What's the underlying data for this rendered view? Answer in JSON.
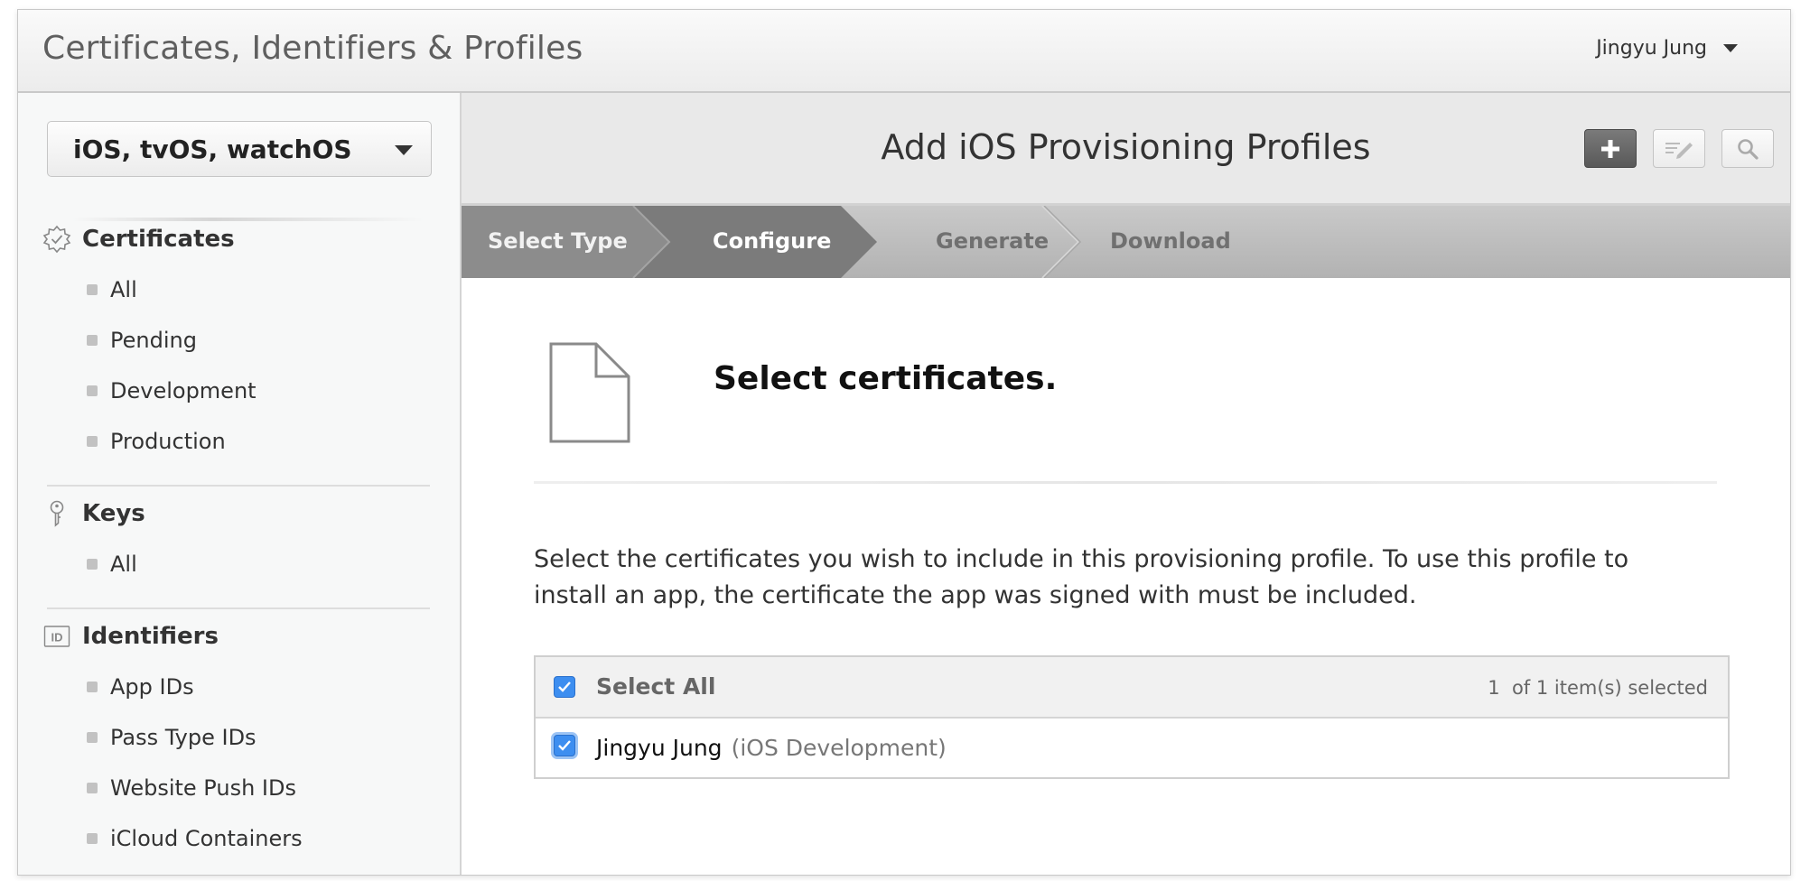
{
  "header": {
    "title": "Certificates, Identifiers & Profiles",
    "user_name": "Jingyu Jung"
  },
  "sidebar": {
    "platform_select": "iOS, tvOS, watchOS",
    "sections": [
      {
        "label": "Certificates",
        "icon": "certificate-badge-icon",
        "items": [
          {
            "label": "All"
          },
          {
            "label": "Pending"
          },
          {
            "label": "Development"
          },
          {
            "label": "Production"
          }
        ]
      },
      {
        "label": "Keys",
        "icon": "key-icon",
        "items": [
          {
            "label": "All"
          }
        ]
      },
      {
        "label": "Identifiers",
        "icon": "id-icon",
        "icon_text": "ID",
        "items": [
          {
            "label": "App IDs"
          },
          {
            "label": "Pass Type IDs"
          },
          {
            "label": "Website Push IDs"
          },
          {
            "label": "iCloud Containers"
          }
        ]
      }
    ]
  },
  "main": {
    "title": "Add iOS Provisioning Profiles",
    "toolbar": {
      "add_icon": "plus-icon",
      "edit_icon": "edit-icon",
      "search_icon": "search-icon"
    },
    "steps": [
      {
        "label": "Select Type",
        "state": "done"
      },
      {
        "label": "Configure",
        "state": "active"
      },
      {
        "label": "Generate",
        "state": "pending"
      },
      {
        "label": "Download",
        "state": "pending"
      }
    ],
    "section_title": "Select certificates.",
    "description": "Select the certificates you wish to include in this provisioning profile. To use this profile to install an app, the certificate the app was signed with must be included.",
    "table": {
      "select_all_label": "Select All",
      "selected_count": "1",
      "count_suffix": "of 1 item(s) selected",
      "rows": [
        {
          "name": "Jingyu Jung",
          "type": "(iOS Development)",
          "checked": true
        }
      ]
    }
  },
  "colors": {
    "step_done": "#888888",
    "step_active": "#7a7a7a",
    "checkbox": "#3d8ef0",
    "active_tool": "#666666"
  }
}
